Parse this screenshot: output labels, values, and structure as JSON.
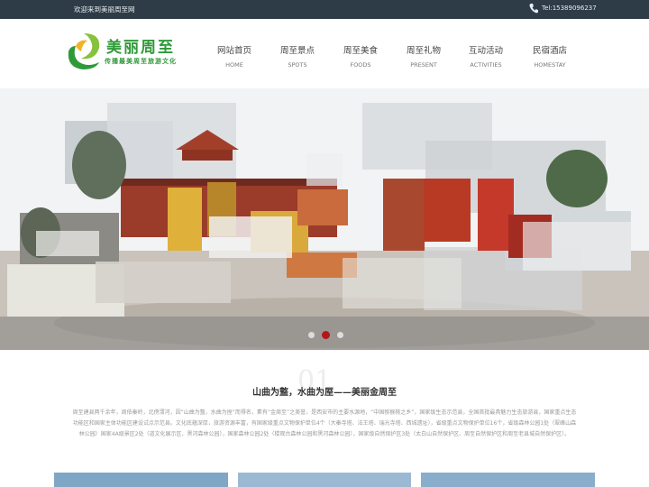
{
  "topbar": {
    "welcome": "欢迎来到美丽周至网",
    "phone": "Tel:15389096237"
  },
  "logo": {
    "title": "美丽周至",
    "subtitle": "传播最美周至旅游文化"
  },
  "nav": [
    {
      "zh": "网站首页",
      "en": "HOME"
    },
    {
      "zh": "周至景点",
      "en": "SPOTS"
    },
    {
      "zh": "周至美食",
      "en": "FOODS"
    },
    {
      "zh": "周至礼物",
      "en": "PRESENT"
    },
    {
      "zh": "互动活动",
      "en": "ACTIVITIES"
    },
    {
      "zh": "民宿酒店",
      "en": "HOMESTAY"
    }
  ],
  "intro": {
    "number": "01",
    "title": "山曲为盩，水曲为厔——美丽金周至",
    "text": "周至建县两千余年，周依秦岭，北傍渭河，因“山曲为盩，水曲为厔”而得名，素有“金周至”之美誉，是西安市的主要水源地，“中国猕猴桃之乡”，国家级生态示范县，全国首批最具魅力生态旅游县，国家重点生态功能区和国家主体功能区建设试点示范县。文化底蕴深厚，旅游资源丰富，有国家级重点文物保护单位4个（大秦寺塔、法王塔、瑞光寺塔、西城遗址），省级重点文物保护单位16个，省级森林公园1处（翠峰山森林公园）国家4A级景区2处（道文化展示区、黑河森林公园），国家森林公园2处（楼观台森林公园和黑河森林公园），国家级自然保护区3处（太白山自然保护区、周至自然保护区和周至老县城自然保护区）。"
  }
}
